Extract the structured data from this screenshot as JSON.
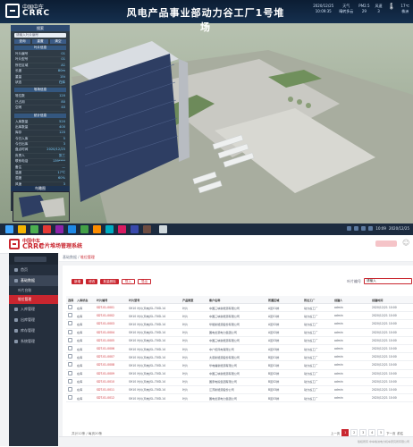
{
  "dashboard": {
    "logo_cn": "中国中车",
    "logo_en": "CRRC",
    "title": "风电产品事业部动力谷工厂1号堆场",
    "date": "2020/12/25",
    "time": "10:09:35",
    "weather_label": "天气",
    "weather_value": "晴转多云",
    "humidity_label": "PM2.5",
    "humidity_value": "29",
    "wind_label": "风速",
    "wind_value": "3",
    "temp_label": "温度",
    "temp_value": "17℃",
    "location": "株洲",
    "panel": {
      "title": "搜索",
      "search_placeholder": "请输入叶片编号",
      "btn1": "查询",
      "btn2": "重置",
      "btn3": "清空",
      "section1": "叶片信息",
      "rows1": [
        {
          "k": "叶片编号",
          "v": "01"
        },
        {
          "k": "叶片型号",
          "v": "01"
        },
        {
          "k": "所在区域",
          "v": "A1"
        },
        {
          "k": "长度",
          "v": "80m"
        },
        {
          "k": "重量",
          "v": "15t"
        },
        {
          "k": "状态",
          "v": "在库"
        }
      ],
      "section2": "堆场信息",
      "rows2": [
        {
          "k": "堆位数",
          "v": "120"
        },
        {
          "k": "已占用",
          "v": "80"
        },
        {
          "k": "空闲",
          "v": "40"
        }
      ],
      "section3": "统计信息",
      "rows3": [
        {
          "k": "入库数量",
          "v": "520"
        },
        {
          "k": "出库数量",
          "v": "400"
        },
        {
          "k": "库存",
          "v": "120"
        },
        {
          "k": "今日入库",
          "v": "5"
        },
        {
          "k": "今日出库",
          "v": "3"
        },
        {
          "k": "盘点时间",
          "v": "2020/12/25"
        },
        {
          "k": "负责人",
          "v": "张三"
        },
        {
          "k": "联系电话",
          "v": "139****"
        },
        {
          "k": "备注",
          "v": "—"
        },
        {
          "k": "温度",
          "v": "17℃"
        },
        {
          "k": "湿度",
          "v": "60%"
        },
        {
          "k": "风速",
          "v": "3"
        }
      ],
      "minimap_title": "鸟瞰图"
    },
    "taskbar_time": "10:09",
    "taskbar_date": "2020/12/25"
  },
  "app": {
    "logo_cn": "中国中车",
    "logo_en": "CRRC",
    "system_name": "叶片堆场管理系统",
    "sidebar": {
      "search": "",
      "items": [
        {
          "label": "首页",
          "icon": "home-icon"
        },
        {
          "label": "基础数据",
          "icon": "grid-icon",
          "active": true
        },
        {
          "label": "叶片台账",
          "sub": true
        },
        {
          "label": "堆位管理",
          "sub": true,
          "current": true
        },
        {
          "label": "入库管理",
          "icon": "in-icon"
        },
        {
          "label": "出库管理",
          "icon": "out-icon"
        },
        {
          "label": "库存管理",
          "icon": "stock-icon"
        },
        {
          "label": "系统管理",
          "icon": "gear-icon"
        }
      ]
    },
    "breadcrumb": {
      "home": "基础数据",
      "sep": "/",
      "current": "堆位管理"
    },
    "toolbar": {
      "add": "新增",
      "edit": "修改",
      "delete": "批量删除",
      "import": "导入",
      "export": "导出"
    },
    "search": {
      "label": "叶片编号",
      "value": "请输入"
    },
    "table": {
      "columns": [
        "选择",
        "入库状态",
        "叶片编号",
        "叶片型号",
        "产品类型",
        "客户名称",
        "所属区域",
        "所在工厂",
        "创建人",
        "创建时间"
      ],
      "rows": [
        [
          "",
          "在库",
          "SDT-01-0001",
          "SH10 叶片(风电)SL-70ID-14",
          "叶片",
          "中国三峡新能源有限公司",
          "A区01排",
          "动力谷工厂",
          "admin",
          "2020/12/21 10:00"
        ],
        [
          "",
          "在库",
          "SDT-01-0002",
          "SH10 叶片(风电)SL-70ID-14",
          "叶片",
          "中国三峡新能源有限公司",
          "A区01排",
          "动力谷工厂",
          "admin",
          "2020/12/21 10:00"
        ],
        [
          "",
          "在库",
          "SDT-01-0003",
          "SH10 叶片(风电)SL-70ID-14",
          "叶片",
          "华能新能源股份有限公司",
          "A区02排",
          "动力谷工厂",
          "admin",
          "2020/12/21 10:00"
        ],
        [
          "",
          "在库",
          "SDT-01-0004",
          "SH10 叶片(风电)SL-70ID-14",
          "叶片",
          "国电龙源电力集团公司",
          "A区02排",
          "动力谷工厂",
          "admin",
          "2020/12/21 10:00"
        ],
        [
          "",
          "在库",
          "SDT-01-0005",
          "SH10 叶片(风电)SL-70ID-14",
          "叶片",
          "中国三峡新能源有限公司",
          "A区03排",
          "动力谷工厂",
          "admin",
          "2020/12/21 10:00"
        ],
        [
          "",
          "在库",
          "SDT-01-0006",
          "SH10 叶片(风电)SL-70ID-14",
          "叶片",
          "中广核风电有限公司",
          "A区03排",
          "动力谷工厂",
          "admin",
          "2020/12/21 10:00"
        ],
        [
          "",
          "在库",
          "SDT-01-0007",
          "SH10 叶片(风电)SL-70ID-14",
          "叶片",
          "大唐新能源股份有限公司",
          "B区01排",
          "动力谷工厂",
          "admin",
          "2020/12/21 10:00"
        ],
        [
          "",
          "在库",
          "SDT-01-0008",
          "SH10 叶片(风电)SL-70ID-14",
          "叶片",
          "华电福新能源有限公司",
          "B区01排",
          "动力谷工厂",
          "admin",
          "2020/12/21 10:00"
        ],
        [
          "",
          "在库",
          "SDT-01-0009",
          "SH10 叶片(风电)SL-70ID-14",
          "叶片",
          "中国三峡新能源有限公司",
          "B区02排",
          "动力谷工厂",
          "admin",
          "2020/12/21 10:00"
        ],
        [
          "",
          "在库",
          "SDT-01-0010",
          "SH10 叶片(风电)SL-70ID-14",
          "叶片",
          "国家电投集团有限公司",
          "B区02排",
          "动力谷工厂",
          "admin",
          "2020/12/21 10:00"
        ],
        [
          "",
          "在库",
          "SDT-01-0011",
          "SH10 叶片(风电)SL-70ID-14",
          "叶片",
          "江苏新能源股份公司",
          "B区03排",
          "动力谷工厂",
          "admin",
          "2020/12/21 10:00"
        ],
        [
          "",
          "在库",
          "SDT-01-0012",
          "SH10 叶片(风电)SL-70ID-14",
          "叶片",
          "国电龙源电力集团公司",
          "B区03排",
          "动力谷工厂",
          "admin",
          "2020/12/21 10:00"
        ]
      ]
    },
    "footer_total": "共计12条 / 每页20条",
    "pager": {
      "prev": "上一页",
      "pages": [
        "1",
        "2",
        "3",
        "4",
        "5"
      ],
      "next": "下一页",
      "goto": "前往"
    },
    "copyright": "版权所有 中车株洲电力机车研究所有限公司"
  }
}
